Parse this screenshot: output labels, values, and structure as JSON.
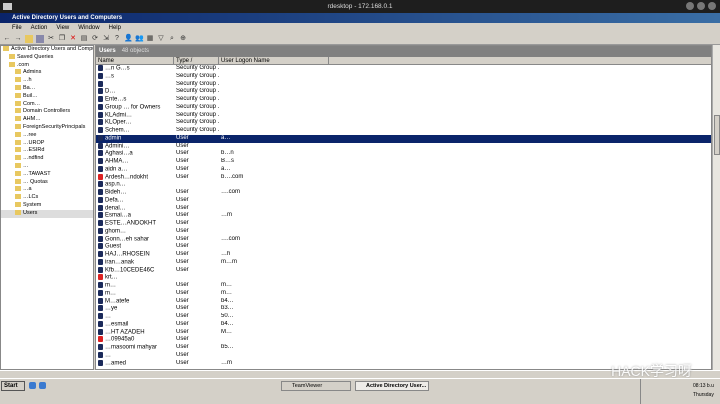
{
  "rdesktop_title": "rdesktop - 172.168.0.1",
  "app_title": "Active Directory Users and Computers",
  "menu": [
    "File",
    "Action",
    "View",
    "Window",
    "Help"
  ],
  "tree": [
    "Active Directory Users and Computers",
    "Saved Queries",
    ".com",
    "Admins",
    "…h",
    "Ba…",
    "Buil…",
    "Com…",
    "Domain Controllers",
    "AHM…",
    "ForeignSecurityPrincipals",
    "…ree",
    "…UROP",
    "…ESIRd",
    "…ndfind",
    "…",
    "…TAWAST",
    "… Quotas",
    "…a",
    "…LCs",
    "System",
    "Users"
  ],
  "pane": {
    "title": "Users",
    "count": "48 objects"
  },
  "columns": [
    "Name",
    "Type  /",
    "User Logon Name"
  ],
  "rows": [
    [
      "…n G…s",
      "Security Group ...",
      "",
      0,
      0
    ],
    [
      "…s",
      "Security Group ...",
      "",
      0,
      0
    ],
    [
      "",
      "Security Group ...",
      "",
      0,
      0
    ],
    [
      "D…",
      "Security Group ...",
      "",
      0,
      0
    ],
    [
      "Ente…s",
      "Security Group ...",
      "",
      0,
      0
    ],
    [
      "Group … for Owners",
      "Security Group ...",
      "",
      0,
      0
    ],
    [
      "KLAdmi…",
      "Security Group ...",
      "",
      0,
      0
    ],
    [
      "KLOper…",
      "Security Group ...",
      "",
      0,
      0
    ],
    [
      "Schem…",
      "Security Group ...",
      "",
      0,
      0
    ],
    [
      "admin",
      "User",
      "a…",
      1,
      0
    ],
    [
      "Admini…",
      "User",
      "",
      0,
      0
    ],
    [
      "Aghasi…a",
      "User",
      "b…n",
      0,
      0
    ],
    [
      "AHMA…",
      "User",
      "B…s",
      0,
      0
    ],
    [
      "aidn a…",
      "User",
      "a…",
      0,
      0
    ],
    [
      "Ardesh…ndokht",
      "User",
      "b….com",
      0,
      1
    ],
    [
      "asp.n…",
      "",
      "",
      0,
      0
    ],
    [
      "Bideh…",
      "User",
      "….com",
      0,
      0
    ],
    [
      "Defa…",
      "User",
      "",
      0,
      0
    ],
    [
      "denal…",
      "User",
      "",
      0,
      0
    ],
    [
      "Esmai…a",
      "User",
      "…m",
      0,
      0
    ],
    [
      "ESTE…ANDOKHT",
      "User",
      "",
      0,
      0
    ],
    [
      "ghom…",
      "User",
      "",
      0,
      0
    ],
    [
      "Gonn…eh sahar",
      "User",
      "….com",
      0,
      0
    ],
    [
      "Guest",
      "User",
      "",
      0,
      0
    ],
    [
      "HAJ…RHOSEIN",
      "User",
      "…h",
      0,
      0
    ],
    [
      "iran…anak",
      "User",
      "m…m",
      0,
      0
    ],
    [
      "Kfb…10CEDE46C",
      "User",
      "",
      0,
      0
    ],
    [
      "krt…",
      "",
      "",
      0,
      1
    ],
    [
      "m…",
      "User",
      "m…",
      0,
      0
    ],
    [
      "m…",
      "User",
      "m…",
      0,
      0
    ],
    [
      "M…atefe",
      "User",
      "b4…",
      0,
      0
    ],
    [
      "…ye",
      "User",
      "b3…",
      0,
      0
    ],
    [
      "…",
      "User",
      "50…",
      0,
      0
    ],
    [
      "…esmail",
      "User",
      "b4…",
      0,
      0
    ],
    [
      "…HT AZADEH",
      "User",
      "M…",
      0,
      0
    ],
    [
      "…09945a0",
      "User",
      "",
      0,
      1
    ],
    [
      "…masoomi mahyar",
      "User",
      "b5…",
      0,
      0
    ],
    [
      "…",
      "User",
      "",
      0,
      0
    ],
    [
      "…amed",
      "User",
      "…m",
      0,
      0
    ]
  ],
  "taskbar": {
    "start": "Start",
    "buttons": [
      "TeamViewer",
      "Active Directory User..."
    ],
    "time": "08:13 b.u",
    "day": "Thursday"
  },
  "watermark": "HACK学习呀"
}
